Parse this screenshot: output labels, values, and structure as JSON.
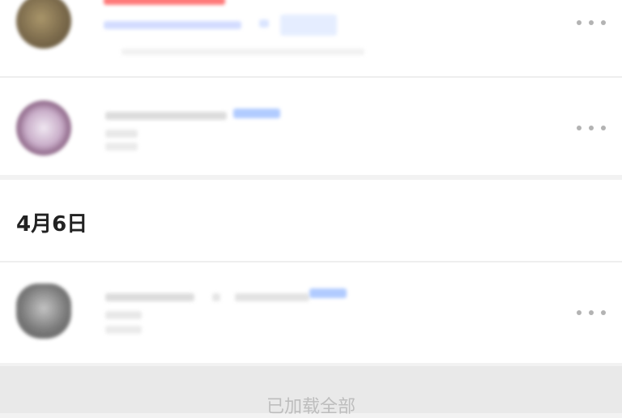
{
  "date_section": {
    "label": "4月6日"
  },
  "footer": {
    "label": "已加载全部"
  },
  "colors": {
    "background": "#f2f2f2",
    "card": "#ffffff",
    "muted_text": "#bdbdbd",
    "blurred_red": "#ff6b6b",
    "blurred_blue": "#8fb6ff"
  },
  "icons": {
    "more": "ellipsis-horizontal-icon"
  }
}
